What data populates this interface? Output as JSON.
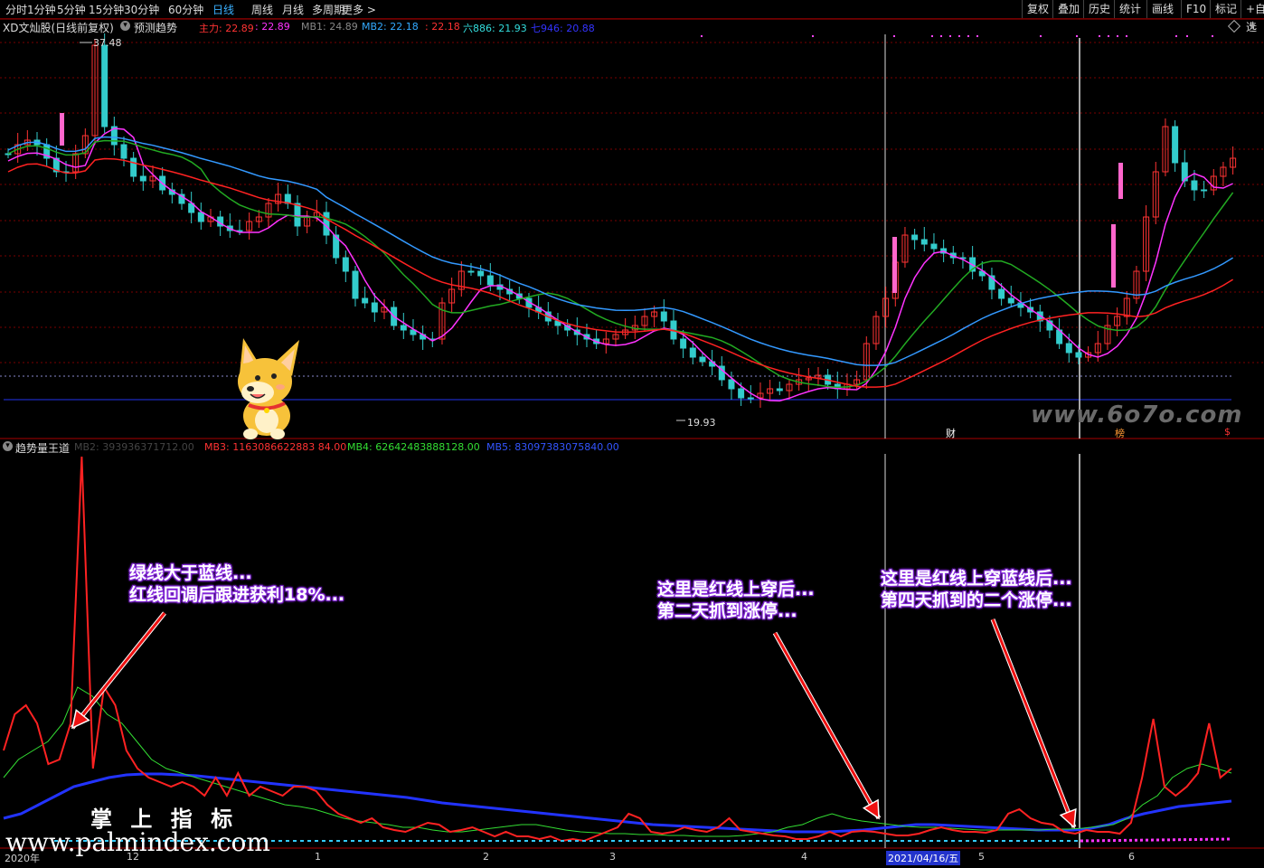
{
  "toolbar": {
    "periods": [
      "分时",
      "1分钟",
      "5分钟",
      "15分钟",
      "30分钟",
      "60分钟",
      "日线",
      "周线",
      "月线",
      "多周期",
      "更多 >"
    ],
    "active_period": "日线",
    "right_buttons": [
      "复权",
      "叠加",
      "历史",
      "统计",
      "画线",
      "F10",
      "标记",
      "+自选"
    ]
  },
  "main_chart": {
    "stock_title": "XD文灿股(日线前复权)",
    "indicator_name": "预测趋势",
    "legend": [
      {
        "label": "主力: 22.89",
        "color": "#ff3333"
      },
      {
        "label": ": 22.89",
        "color": "#ff33ff"
      },
      {
        "label": "MB1: 24.89",
        "color": "#888888"
      },
      {
        "label": "MB2: 22.18",
        "color": "#33aaff"
      },
      {
        "label": ": 22.18",
        "color": "#ff3333"
      },
      {
        "label": "六886: 21.93",
        "color": "#33dddd"
      },
      {
        "label": "七946: 20.88",
        "color": "#3333ff"
      }
    ],
    "high_price": "37.48",
    "low_price": "19.93",
    "event_labels": [
      "财",
      "榜",
      "$"
    ]
  },
  "sub_chart": {
    "indicator_name": "趋势量王道",
    "legend": [
      {
        "label": "MB2: 393936371712.00",
        "color": "#444444"
      },
      {
        "label": "MB3: 1163086622883 84.00",
        "color": "#ff3333"
      },
      {
        "label": "MB4: 62642483888128.00",
        "color": "#33dd33"
      },
      {
        "label": "MB5: 83097383075840.00",
        "color": "#3355ff"
      }
    ]
  },
  "annotations": [
    {
      "lines": [
        "绿线大于蓝线...",
        "红线回调后跟进获利18%..."
      ]
    },
    {
      "lines": [
        "这里是红线上穿后...",
        "第二天抓到涨停..."
      ]
    },
    {
      "lines": [
        "这里是红线上穿蓝线后...",
        "第四天抓到的二个涨停..."
      ]
    }
  ],
  "x_axis": {
    "labels": [
      "2020年",
      "12",
      "1",
      "2",
      "3",
      "4",
      "2021/04/16/五",
      "5",
      "6"
    ]
  },
  "watermarks": {
    "top_right": "www.6o7o.com",
    "brand_cn": "掌 上 指 标",
    "brand_url": "www.palmindex.com"
  },
  "colors": {
    "up": "#ff3333",
    "down": "#33cccc",
    "limit_up": "#ff66cc",
    "green_line": "#22aa22",
    "blue_line": "#3399ff",
    "red_line": "#ff2222",
    "magenta_line": "#ff33ff",
    "sub_blue": "#2233ff"
  }
}
